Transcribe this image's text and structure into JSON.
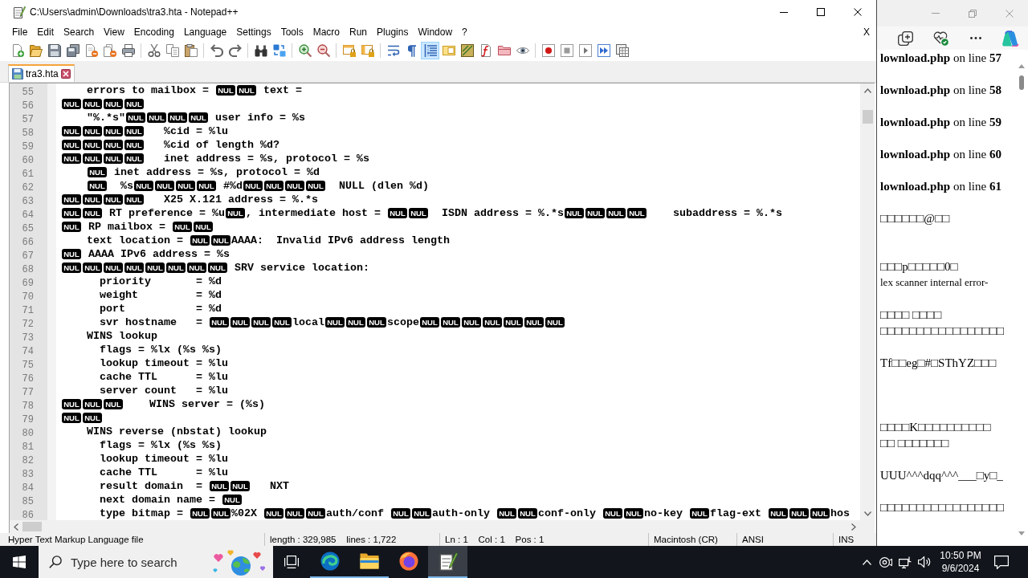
{
  "notepad": {
    "title": "C:\\Users\\admin\\Downloads\\tra3.hta - Notepad++",
    "menu": [
      "File",
      "Edit",
      "Search",
      "View",
      "Encoding",
      "Language",
      "Settings",
      "Tools",
      "Macro",
      "Run",
      "Plugins",
      "Window",
      "?"
    ],
    "menu_close": "X",
    "toolbar": [
      {
        "on": false
      },
      {
        "on": false
      },
      {
        "on": false
      },
      {
        "on": false
      },
      {
        "on": false
      },
      {
        "on": false
      },
      {
        "on": false
      },
      {
        "on": false
      },
      {
        "on": false
      },
      {
        "on": false
      },
      {
        "on": false
      },
      {
        "on": false
      },
      {
        "on": false
      },
      {
        "on": false
      },
      {
        "on": false
      },
      {
        "on": false
      },
      {
        "on": false
      },
      {
        "on": false
      },
      {
        "on": false
      },
      {
        "on": false
      },
      {
        "on": true
      },
      {
        "on": false
      },
      {
        "on": false
      },
      {
        "on": false
      },
      {
        "on": false
      },
      {
        "on": false
      },
      {
        "on": false
      },
      {
        "on": false
      },
      {
        "on": false
      },
      {
        "on": false
      },
      {
        "on": false
      }
    ],
    "tabs": [
      {
        "label": "tra3.hta",
        "selected": true
      }
    ],
    "editor": {
      "lines": [
        {
          "number": "55",
          "parts": [
            {
              "kind": "text",
              "text": "    errors to mailbox = "
            },
            {
              "kind": "control",
              "text": "NUL"
            },
            {
              "kind": "control",
              "text": "NUL"
            },
            {
              "kind": "text",
              "text": " text ="
            }
          ]
        },
        {
          "number": "56",
          "parts": [
            {
              "kind": "control",
              "text": "NUL"
            },
            {
              "kind": "control",
              "text": "NUL"
            },
            {
              "kind": "control",
              "text": "NUL"
            },
            {
              "kind": "control",
              "text": "NUL"
            }
          ]
        },
        {
          "number": "57",
          "parts": [
            {
              "kind": "text",
              "text": "    \"%.*s\""
            },
            {
              "kind": "control",
              "text": "NUL"
            },
            {
              "kind": "control",
              "text": "NUL"
            },
            {
              "kind": "control",
              "text": "NUL"
            },
            {
              "kind": "control",
              "text": "NUL"
            },
            {
              "kind": "text",
              "text": " user info = %s"
            }
          ]
        },
        {
          "number": "58",
          "parts": [
            {
              "kind": "control",
              "text": "NUL"
            },
            {
              "kind": "control",
              "text": "NUL"
            },
            {
              "kind": "control",
              "text": "NUL"
            },
            {
              "kind": "control",
              "text": "NUL"
            },
            {
              "kind": "text",
              "text": "   %cid = %lu"
            }
          ]
        },
        {
          "number": "59",
          "parts": [
            {
              "kind": "control",
              "text": "NUL"
            },
            {
              "kind": "control",
              "text": "NUL"
            },
            {
              "kind": "control",
              "text": "NUL"
            },
            {
              "kind": "control",
              "text": "NUL"
            },
            {
              "kind": "text",
              "text": "   %cid of length %d?"
            }
          ]
        },
        {
          "number": "60",
          "parts": [
            {
              "kind": "control",
              "text": "NUL"
            },
            {
              "kind": "control",
              "text": "NUL"
            },
            {
              "kind": "control",
              "text": "NUL"
            },
            {
              "kind": "control",
              "text": "NUL"
            },
            {
              "kind": "text",
              "text": "   inet address = %s, protocol = %s"
            }
          ]
        },
        {
          "number": "61",
          "parts": [
            {
              "kind": "tab"
            },
            {
              "kind": "control",
              "text": "NUL"
            },
            {
              "kind": "text",
              "text": " inet address = %s, protocol = %d"
            }
          ]
        },
        {
          "number": "62",
          "parts": [
            {
              "kind": "tab"
            },
            {
              "kind": "control",
              "text": "NUL"
            },
            {
              "kind": "text",
              "text": "  %s"
            },
            {
              "kind": "control",
              "text": "NUL"
            },
            {
              "kind": "control",
              "text": "NUL"
            },
            {
              "kind": "control",
              "text": "NUL"
            },
            {
              "kind": "control",
              "text": "NUL"
            },
            {
              "kind": "text",
              "text": " #%d"
            },
            {
              "kind": "control",
              "text": "NUL"
            },
            {
              "kind": "control",
              "text": "NUL"
            },
            {
              "kind": "control",
              "text": "NUL"
            },
            {
              "kind": "control",
              "text": "NUL"
            },
            {
              "kind": "text",
              "text": "  NULL (dlen %d)"
            }
          ]
        },
        {
          "number": "63",
          "parts": [
            {
              "kind": "control",
              "text": "NUL"
            },
            {
              "kind": "control",
              "text": "NUL"
            },
            {
              "kind": "control",
              "text": "NUL"
            },
            {
              "kind": "control",
              "text": "NUL"
            },
            {
              "kind": "text",
              "text": "   X25 X.121 address = %.*s"
            }
          ]
        },
        {
          "number": "64",
          "parts": [
            {
              "kind": "control",
              "text": "NUL"
            },
            {
              "kind": "control",
              "text": "NUL"
            },
            {
              "kind": "text",
              "text": " RT preference = %u"
            },
            {
              "kind": "control",
              "text": "NUL"
            },
            {
              "kind": "text",
              "text": ", intermediate host = "
            },
            {
              "kind": "control",
              "text": "NUL"
            },
            {
              "kind": "control",
              "text": "NUL"
            },
            {
              "kind": "text",
              "text": "  ISDN address = %.*s"
            },
            {
              "kind": "control",
              "text": "NUL"
            },
            {
              "kind": "control",
              "text": "NUL"
            },
            {
              "kind": "control",
              "text": "NUL"
            },
            {
              "kind": "control",
              "text": "NUL"
            },
            {
              "kind": "text",
              "text": "    subaddress = %.*s"
            }
          ]
        },
        {
          "number": "65",
          "parts": [
            {
              "kind": "control",
              "text": "NUL"
            },
            {
              "kind": "text",
              "text": " RP mailbox = "
            },
            {
              "kind": "control",
              "text": "NUL"
            },
            {
              "kind": "control",
              "text": "NUL"
            }
          ]
        },
        {
          "number": "66",
          "parts": [
            {
              "kind": "text",
              "text": "    text location = "
            },
            {
              "kind": "control",
              "text": "NUL"
            },
            {
              "kind": "control",
              "text": "NUL"
            },
            {
              "kind": "text",
              "text": "AAAA:  Invalid IPv6 address length"
            }
          ]
        },
        {
          "number": "67",
          "parts": [
            {
              "kind": "control",
              "text": "NUL"
            },
            {
              "kind": "text",
              "text": " AAAA IPv6 address = %s"
            }
          ]
        },
        {
          "number": "68",
          "parts": [
            {
              "kind": "control",
              "text": "NUL"
            },
            {
              "kind": "control",
              "text": "NUL"
            },
            {
              "kind": "control",
              "text": "NUL"
            },
            {
              "kind": "control",
              "text": "NUL"
            },
            {
              "kind": "control",
              "text": "NUL"
            },
            {
              "kind": "control",
              "text": "NUL"
            },
            {
              "kind": "control",
              "text": "NUL"
            },
            {
              "kind": "control",
              "text": "NUL"
            },
            {
              "kind": "text",
              "text": " SRV service location:"
            }
          ]
        },
        {
          "number": "69",
          "parts": [
            {
              "kind": "text",
              "text": "      priority       = %d"
            }
          ]
        },
        {
          "number": "70",
          "parts": [
            {
              "kind": "text",
              "text": "      weight         = %d"
            }
          ]
        },
        {
          "number": "71",
          "parts": [
            {
              "kind": "text",
              "text": "      port           = %d"
            }
          ]
        },
        {
          "number": "72",
          "parts": [
            {
              "kind": "text",
              "text": "      svr hostname   = "
            },
            {
              "kind": "control",
              "text": "NUL"
            },
            {
              "kind": "control",
              "text": "NUL"
            },
            {
              "kind": "control",
              "text": "NUL"
            },
            {
              "kind": "control",
              "text": "NUL"
            },
            {
              "kind": "text",
              "text": "local"
            },
            {
              "kind": "control",
              "text": "NUL"
            },
            {
              "kind": "control",
              "text": "NUL"
            },
            {
              "kind": "control",
              "text": "NUL"
            },
            {
              "kind": "text",
              "text": "scope"
            },
            {
              "kind": "control",
              "text": "NUL"
            },
            {
              "kind": "control",
              "text": "NUL"
            },
            {
              "kind": "control",
              "text": "NUL"
            },
            {
              "kind": "control",
              "text": "NUL"
            },
            {
              "kind": "control",
              "text": "NUL"
            },
            {
              "kind": "control",
              "text": "NUL"
            },
            {
              "kind": "control",
              "text": "NUL"
            }
          ]
        },
        {
          "number": "73",
          "parts": [
            {
              "kind": "text",
              "text": "    WINS lookup"
            }
          ]
        },
        {
          "number": "74",
          "parts": [
            {
              "kind": "text",
              "text": "      flags = %lx (%s %s)"
            }
          ]
        },
        {
          "number": "75",
          "parts": [
            {
              "kind": "text",
              "text": "      lookup timeout = %lu"
            }
          ]
        },
        {
          "number": "76",
          "parts": [
            {
              "kind": "text",
              "text": "      cache TTL      = %lu"
            }
          ]
        },
        {
          "number": "77",
          "parts": [
            {
              "kind": "text",
              "text": "      server count   = %lu"
            }
          ]
        },
        {
          "number": "78",
          "parts": [
            {
              "kind": "control",
              "text": "NUL"
            },
            {
              "kind": "control",
              "text": "NUL"
            },
            {
              "kind": "control",
              "text": "NUL"
            },
            {
              "kind": "text",
              "text": "    WINS server = (%s)"
            }
          ]
        },
        {
          "number": "79",
          "parts": [
            {
              "kind": "control",
              "text": "NUL"
            },
            {
              "kind": "control",
              "text": "NUL"
            }
          ]
        },
        {
          "number": "80",
          "parts": [
            {
              "kind": "text",
              "text": "    WINS reverse (nbstat) lookup"
            }
          ]
        },
        {
          "number": "81",
          "parts": [
            {
              "kind": "text",
              "text": "      flags = %lx (%s %s)"
            }
          ]
        },
        {
          "number": "82",
          "parts": [
            {
              "kind": "text",
              "text": "      lookup timeout = %lu"
            }
          ]
        },
        {
          "number": "83",
          "parts": [
            {
              "kind": "text",
              "text": "      cache TTL      = %lu"
            }
          ]
        },
        {
          "number": "84",
          "parts": [
            {
              "kind": "text",
              "text": "      result domain  = "
            },
            {
              "kind": "control",
              "text": "NUL"
            },
            {
              "kind": "control",
              "text": "NUL"
            },
            {
              "kind": "text",
              "text": "   NXT"
            }
          ]
        },
        {
          "number": "85",
          "parts": [
            {
              "kind": "text",
              "text": "      next domain name = "
            },
            {
              "kind": "control",
              "text": "NUL"
            }
          ]
        },
        {
          "number": "86",
          "parts": [
            {
              "kind": "text",
              "text": "      type bitmap = "
            },
            {
              "kind": "control",
              "text": "NUL"
            },
            {
              "kind": "control",
              "text": "NUL"
            },
            {
              "kind": "text",
              "text": "%02X "
            },
            {
              "kind": "control",
              "text": "NUL"
            },
            {
              "kind": "control",
              "text": "NUL"
            },
            {
              "kind": "control",
              "text": "NUL"
            },
            {
              "kind": "text",
              "text": "auth/conf "
            },
            {
              "kind": "control",
              "text": "NUL"
            },
            {
              "kind": "control",
              "text": "NUL"
            },
            {
              "kind": "text",
              "text": "auth-only "
            },
            {
              "kind": "control",
              "text": "NUL"
            },
            {
              "kind": "control",
              "text": "NUL"
            },
            {
              "kind": "text",
              "text": "conf-only "
            },
            {
              "kind": "control",
              "text": "NUL"
            },
            {
              "kind": "control",
              "text": "NUL"
            },
            {
              "kind": "text",
              "text": "no-key "
            },
            {
              "kind": "control",
              "text": "NUL"
            },
            {
              "kind": "text",
              "text": "flag-ext "
            },
            {
              "kind": "control",
              "text": "NUL"
            },
            {
              "kind": "control",
              "text": "NUL"
            },
            {
              "kind": "control",
              "text": "NUL"
            },
            {
              "kind": "text",
              "text": "hos"
            }
          ]
        }
      ]
    },
    "status_bar": [
      "Hyper Text Markup Language file",
      "length : 329,985    lines : 1,722",
      "Ln : 1    Col : 1    Pos : 1",
      "Macintosh (CR)",
      "ANSI",
      "INS"
    ]
  },
  "browser": {
    "lines": [
      {
        "kind": "text",
        "text": "**lownload.php** on line **57**"
      },
      {
        "kind": "text",
        "text": "**lownload.php** on line **58**"
      },
      {
        "kind": "text",
        "text": "**lownload.php** on line **59**"
      },
      {
        "kind": "text",
        "text": "**lownload.php** on line **60**"
      },
      {
        "kind": "text",
        "text": "**lownload.php** on line **61**"
      },
      {
        "kind": "text",
        "text": "□□□□□□@□□"
      },
      {
        "kind": "text",
        "text": "□□□p□□□□□0□"
      },
      {
        "kind": "small",
        "text": "lex scanner internal error-"
      },
      {
        "kind": "text",
        "text": "□□□□ □□□□"
      },
      {
        "kind": "text",
        "text": "□□□□□□□□□□□□□□□□□"
      },
      {
        "kind": "text",
        "text": "Tf□□eg□#□SThYZ□□□"
      },
      {
        "kind": "text",
        "text": "□□□□K□□□□□□□□□□"
      },
      {
        "kind": "text",
        "text": "□□ □□□□□□□"
      },
      {
        "kind": "text",
        "text": "UUU^^^dqq^^^___□y□_"
      },
      {
        "kind": "text",
        "text": "□□□□□□□□□□□□□□□□□"
      }
    ]
  },
  "taskbar": {
    "search": {
      "placeholder": "Type here to search"
    },
    "apps": [
      {
        "running": true,
        "selected": false
      },
      {
        "running": true,
        "selected": false
      },
      {
        "running": false,
        "selected": false
      },
      {
        "running": true,
        "selected": true
      }
    ],
    "clock": {
      "time": "10:50 PM",
      "date": "9/6/2024"
    }
  }
}
